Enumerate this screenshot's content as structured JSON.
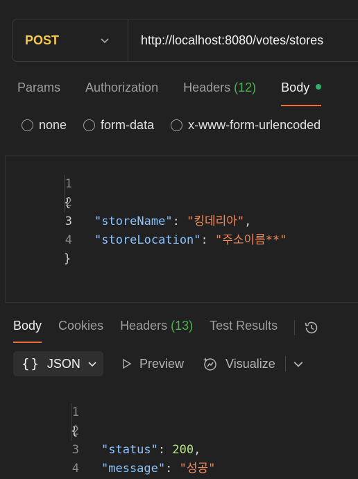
{
  "request": {
    "method": "POST",
    "url": "http://localhost:8080/votes/stores"
  },
  "request_tabs": [
    {
      "label": "Params"
    },
    {
      "label": "Authorization"
    },
    {
      "label": "Headers",
      "count": "(12)"
    },
    {
      "label": "Body",
      "active": true
    }
  ],
  "body_types": [
    "none",
    "form-data",
    "x-www-form-urlencoded"
  ],
  "request_body": {
    "line_numbers": [
      "1",
      "2",
      "3",
      "4"
    ],
    "open_brace": "{",
    "close_brace": "}",
    "key1": "\"storeName\"",
    "val1": "\"킹데리아\"",
    "key2": "\"storeLocation\"",
    "val2": "\"주소이름**\"",
    "colon": ": ",
    "comma": ","
  },
  "response_tabs": [
    {
      "label": "Body",
      "active": true
    },
    {
      "label": "Cookies"
    },
    {
      "label": "Headers",
      "count": "(13)"
    },
    {
      "label": "Test Results"
    }
  ],
  "response_toolbar": {
    "format": "JSON",
    "braces": "{}",
    "preview": "Preview",
    "visualize": "Visualize"
  },
  "response_body": {
    "line_numbers": [
      "1",
      "2",
      "3",
      "4"
    ],
    "open_brace": "{",
    "close_brace": "}",
    "key1": "\"status\"",
    "val1": "200",
    "key2": "\"message\"",
    "val2": "\"성공\"",
    "colon": ": ",
    "comma": ","
  },
  "colors": {
    "method": "#f5c84c",
    "active_tab_underline": "#f26b3a",
    "count": "#4caf50",
    "json_key": "#8bc4ff",
    "json_string": "#f0875a",
    "json_number": "#b9e28c"
  }
}
